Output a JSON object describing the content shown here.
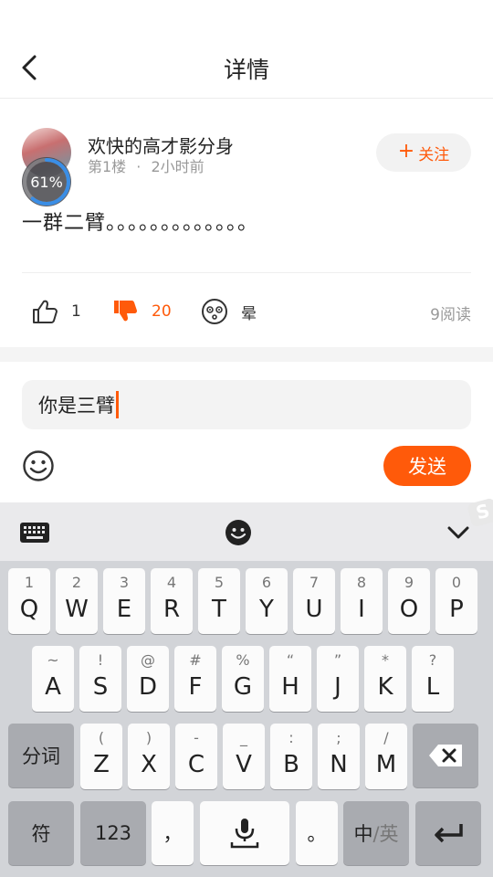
{
  "header": {
    "title": "详情",
    "back_icon": "chevron-left-icon"
  },
  "post": {
    "username": "欢快的高才影分身",
    "floor": "第1楼",
    "dot": "·",
    "time": "2小时前",
    "follow_label": "关注",
    "follow_plus": "+",
    "upload_progress": "61%",
    "upload_progress_value": 0.61,
    "content": "一群二臂。。。。。。。。。。。。。",
    "likes": "1",
    "dislikes": "20",
    "dizzy_label": "晕",
    "reads": "9阅读"
  },
  "comment": {
    "input_value": "你是三臂",
    "send_label": "发送"
  },
  "keyboard": {
    "row1": [
      {
        "sub": "1",
        "main": "Q"
      },
      {
        "sub": "2",
        "main": "W"
      },
      {
        "sub": "3",
        "main": "E"
      },
      {
        "sub": "4",
        "main": "R"
      },
      {
        "sub": "5",
        "main": "T"
      },
      {
        "sub": "6",
        "main": "Y"
      },
      {
        "sub": "7",
        "main": "U"
      },
      {
        "sub": "8",
        "main": "I"
      },
      {
        "sub": "9",
        "main": "O"
      },
      {
        "sub": "0",
        "main": "P"
      }
    ],
    "row2": [
      {
        "sub": "~",
        "main": "A"
      },
      {
        "sub": "!",
        "main": "S"
      },
      {
        "sub": "@",
        "main": "D"
      },
      {
        "sub": "#",
        "main": "F"
      },
      {
        "sub": "%",
        "main": "G"
      },
      {
        "sub": "“",
        "main": "H"
      },
      {
        "sub": "”",
        "main": "J"
      },
      {
        "sub": "*",
        "main": "K"
      },
      {
        "sub": "?",
        "main": "L"
      }
    ],
    "row3": [
      {
        "sub": "(",
        "main": "Z"
      },
      {
        "sub": ")",
        "main": "X"
      },
      {
        "sub": "-",
        "main": "C"
      },
      {
        "sub": "_",
        "main": "V"
      },
      {
        "sub": ":",
        "main": "B"
      },
      {
        "sub": ";",
        "main": "N"
      },
      {
        "sub": "/",
        "main": "M"
      }
    ],
    "segment_label": "分词",
    "symbol_label": "符",
    "number_label": "123",
    "comma_label": "，",
    "period_label": "。",
    "lang_primary": "中",
    "lang_secondary": "/英",
    "watermark": "S"
  }
}
